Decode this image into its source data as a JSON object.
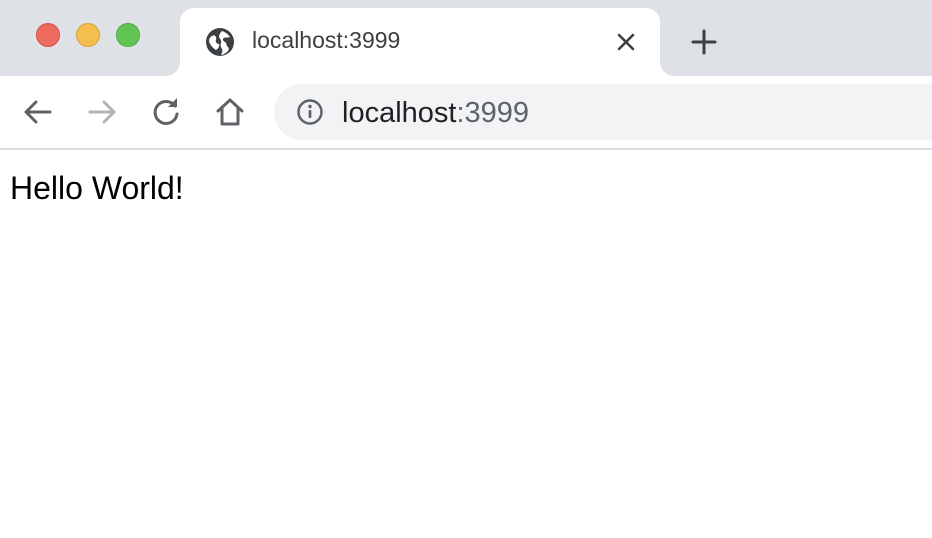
{
  "window": {
    "controls": [
      "close",
      "minimize",
      "maximize"
    ]
  },
  "tab": {
    "title": "localhost:3999",
    "favicon": "globe-icon",
    "close_icon": "close-icon"
  },
  "new_tab_icon": "plus-icon",
  "toolbar": {
    "back_icon": "back-arrow-icon",
    "forward_icon": "forward-arrow-icon",
    "reload_icon": "reload-icon",
    "home_icon": "home-icon"
  },
  "omnibox": {
    "site_info_icon": "info-icon",
    "url_host": "localhost",
    "url_rest": ":3999"
  },
  "page": {
    "text": "Hello World!"
  },
  "colors": {
    "tabstrip": "#dee1e6",
    "close": "#ed6a5e",
    "minimize": "#f5bf4f",
    "maximize": "#61c554",
    "omnibox": "#f1f3f4"
  }
}
